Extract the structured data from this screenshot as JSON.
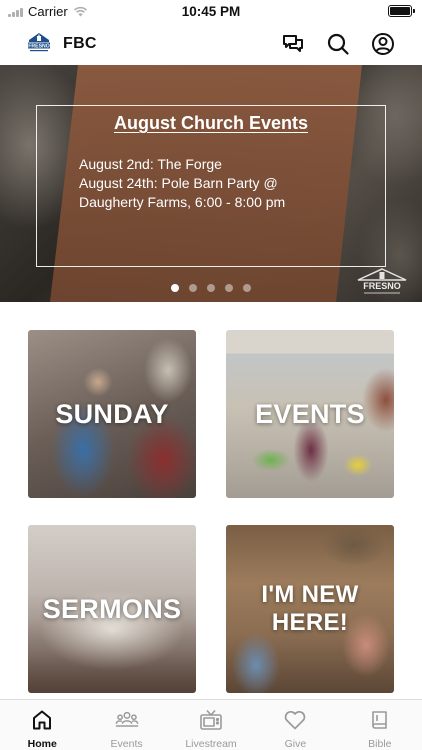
{
  "status_bar": {
    "carrier": "Carrier",
    "time": "10:45 PM"
  },
  "header": {
    "title": "FBC",
    "logo_text": "FRESNO",
    "icons": [
      "chat-icon",
      "search-icon",
      "account-icon"
    ]
  },
  "hero": {
    "title": "August Church Events",
    "lines": [
      "August 2nd:  The Forge",
      "August 24th:  Pole Barn Party @",
      "Daugherty Farms, 6:00 - 8:00 pm"
    ],
    "badge_text": "FRESNO",
    "slide_count": 5,
    "active_slide": 1
  },
  "tiles": [
    {
      "label": "SUNDAY"
    },
    {
      "label": "EVENTS"
    },
    {
      "label": "SERMONS"
    },
    {
      "label": "I'M NEW HERE!"
    }
  ],
  "tab_bar": {
    "tabs": [
      {
        "label": "Home",
        "icon": "home-icon",
        "active": true
      },
      {
        "label": "Events",
        "icon": "people-icon",
        "active": false
      },
      {
        "label": "Livestream",
        "icon": "tv-icon",
        "active": false
      },
      {
        "label": "Give",
        "icon": "heart-icon",
        "active": false
      },
      {
        "label": "Bible",
        "icon": "book-icon",
        "active": false
      }
    ]
  },
  "colors": {
    "hero_panel": "#7a4d36",
    "active_tab": "#111111",
    "inactive_tab": "#9a9a9a",
    "logo_blue": "#1f4f8a"
  }
}
